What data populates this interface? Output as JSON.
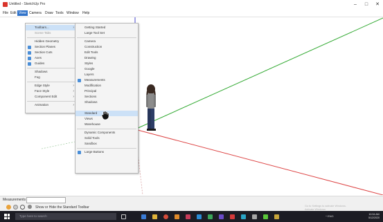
{
  "window": {
    "title": "Untitled - SketchUp Pro",
    "minimize_glyph": "–",
    "maximize_glyph": "□",
    "close_glyph": "✕"
  },
  "menubar": {
    "items": [
      "File",
      "Edit",
      "View",
      "Camera",
      "Draw",
      "Tools",
      "Window",
      "Help"
    ],
    "active_index": 2
  },
  "view_menu": {
    "items": [
      {
        "label": "Toolbars...",
        "submenu": true,
        "checked": false,
        "selected": true
      },
      {
        "label": "Scene Tabs",
        "checked": false
      },
      {
        "separator": true
      },
      {
        "label": "Hidden Geometry",
        "checked": false
      },
      {
        "label": "Section Planes",
        "checked": true
      },
      {
        "label": "Section Cuts",
        "checked": true
      },
      {
        "label": "Axes",
        "checked": true
      },
      {
        "label": "Guides",
        "checked": true
      },
      {
        "separator": true
      },
      {
        "label": "Shadows",
        "checked": false
      },
      {
        "label": "Fog",
        "checked": false
      },
      {
        "separator": true
      },
      {
        "label": "Edge Style",
        "submenu": true
      },
      {
        "label": "Face Style",
        "submenu": true
      },
      {
        "label": "Component Edit",
        "submenu": true
      },
      {
        "separator": true
      },
      {
        "label": "Animation",
        "submenu": true
      }
    ]
  },
  "toolbars_submenu": {
    "items": [
      {
        "label": "Getting Started",
        "checked": false
      },
      {
        "label": "Large Tool Set",
        "checked": false
      },
      {
        "separator": true
      },
      {
        "label": "Camera",
        "checked": false
      },
      {
        "label": "Construction",
        "checked": false
      },
      {
        "label": "Edit Tools",
        "checked": false
      },
      {
        "label": "Drawing",
        "checked": false
      },
      {
        "label": "Styles",
        "checked": false
      },
      {
        "label": "Google",
        "checked": false
      },
      {
        "label": "Layers",
        "checked": false
      },
      {
        "label": "Measurements",
        "checked": true
      },
      {
        "label": "Modification",
        "checked": false
      },
      {
        "label": "Principal",
        "checked": false
      },
      {
        "label": "Sections",
        "checked": false
      },
      {
        "label": "Shadows",
        "checked": false
      },
      {
        "label": "Standard",
        "checked": false,
        "hovered": true
      },
      {
        "label": "Views",
        "checked": false
      },
      {
        "label": "Warehouse",
        "checked": false
      },
      {
        "separator": true
      },
      {
        "label": "Dynamic Components",
        "checked": false
      },
      {
        "label": "Solid Tools",
        "checked": false
      },
      {
        "label": "Sandbox",
        "checked": false
      },
      {
        "separator": true
      },
      {
        "label": "Large Buttons",
        "checked": true
      }
    ]
  },
  "measurements": {
    "label": "Measurements",
    "value": ""
  },
  "statusbar": {
    "text": "Show or Hide the Standard Toolbar",
    "right_line1": "Go to Settings to activate Windows.",
    "right_line2": "Activate Windows"
  },
  "taskbar": {
    "search_placeholder": "Type here to search",
    "tray_text": "^ ENG",
    "time": "10:34 AM",
    "date": "5/12/2020"
  },
  "colors": {
    "accent": "#2f72c9",
    "axis_red": "#d44",
    "axis_green": "#3a3",
    "axis_blue": "#44c",
    "taskbar": "#1c1c24"
  }
}
